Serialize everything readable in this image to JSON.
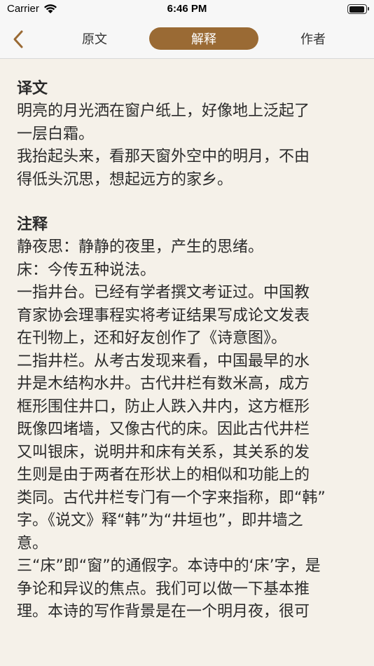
{
  "status": {
    "carrier": "Carrier",
    "time": "6:46 PM"
  },
  "nav": {
    "tabs": [
      "原文",
      "解释",
      "作者"
    ],
    "active_tab": "解释",
    "accent_color": "#9a6a34"
  },
  "translation": {
    "title": "译文",
    "lines": [
      "明亮的月光洒在窗户纸上，好像地上泛起了",
      "一层白霜。",
      "我抬起头来，看那天窗外空中的明月，不由",
      "得低头沉思，想起远方的家乡。"
    ]
  },
  "notes": {
    "title": "注释",
    "lines": [
      "静夜思：静静的夜里，产生的思绪。",
      "床：今传五种说法。",
      "一指井台。已经有学者撰文考证过。中国教",
      "育家协会理事程实将考证结果写成论文发表",
      "在刊物上，还和好友创作了《诗意图》。",
      "二指井栏。从考古发现来看，中国最早的水",
      "井是木结构水井。古代井栏有数米高，成方",
      "框形围住井口，防止人跌入井内，这方框形",
      "既像四堵墙，又像古代的床。因此古代井栏",
      "又叫银床，说明井和床有关系，其关系的发",
      "生则是由于两者在形状上的相似和功能上的",
      "类同。古代井栏专门有一个字来指称，即“韩”",
      "字。《说文》释“韩”为“井垣也”，即井墙之",
      "意。",
      "三“床”即“窗”的通假字。本诗中的‘床’字，是",
      "争论和异议的焦点。我们可以做一下基本推",
      "理。本诗的写作背景是在一个明月夜，很可"
    ]
  }
}
